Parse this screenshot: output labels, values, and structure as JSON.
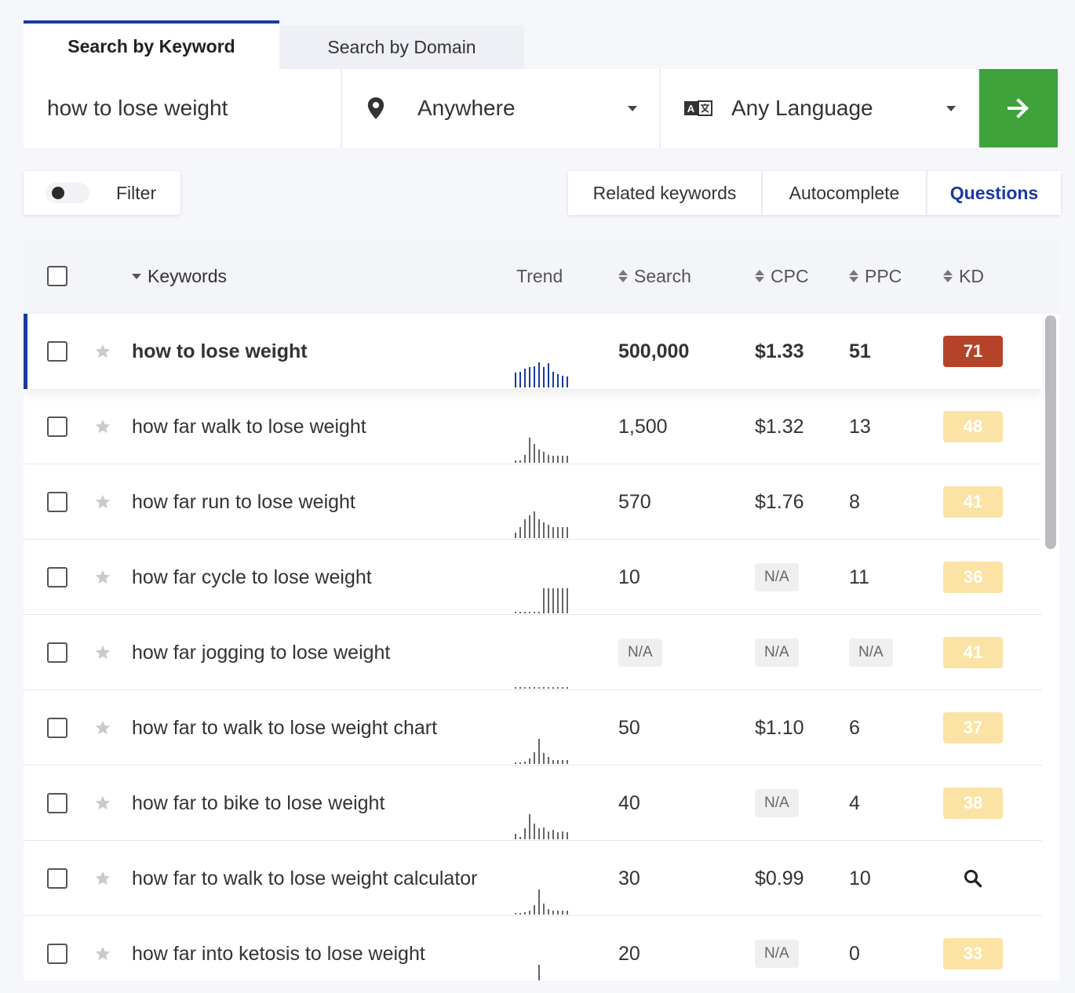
{
  "tabs": {
    "keyword_label": "Search by Keyword",
    "domain_label": "Search by Domain"
  },
  "search": {
    "keyword": "how to lose weight",
    "location": "Anywhere",
    "language": "Any Language"
  },
  "filter": {
    "label": "Filter",
    "enabled": false
  },
  "views": {
    "related": "Related keywords",
    "autocomplete": "Autocomplete",
    "questions": "Questions",
    "active": "questions"
  },
  "columns": {
    "keywords": "Keywords",
    "trend": "Trend",
    "search": "Search",
    "cpc": "CPC",
    "ppc": "PPC",
    "kd": "KD"
  },
  "colors": {
    "accent_blue": "#1b3aa0",
    "go_green": "#3da33a",
    "kd_hard": "#b5432a",
    "kd_medium": "#fbe3a6",
    "trend_selected": "#1b3aa0",
    "trend_default": "#666666"
  },
  "rows": [
    {
      "keyword": "how to lose weight",
      "search": "500,000",
      "cpc": "$1.33",
      "ppc": "51",
      "kd": "71",
      "kd_level": "hard",
      "selected": true,
      "trend": [
        0.55,
        0.6,
        0.7,
        0.75,
        0.8,
        0.95,
        0.75,
        0.9,
        0.6,
        0.5,
        0.45,
        0.4
      ]
    },
    {
      "keyword": "how far walk to lose weight",
      "search": "1,500",
      "cpc": "$1.32",
      "ppc": "13",
      "kd": "48",
      "kd_level": "medium",
      "selected": false,
      "trend": [
        0.1,
        0.1,
        0.3,
        0.95,
        0.7,
        0.5,
        0.4,
        0.3,
        0.25,
        0.25,
        0.25,
        0.25
      ]
    },
    {
      "keyword": "how far run to lose weight",
      "search": "570",
      "cpc": "$1.76",
      "ppc": "8",
      "kd": "41",
      "kd_level": "medium",
      "selected": false,
      "trend": [
        0.2,
        0.4,
        0.7,
        0.85,
        1.0,
        0.7,
        0.6,
        0.5,
        0.4,
        0.4,
        0.4,
        0.4
      ]
    },
    {
      "keyword": "how far cycle to lose weight",
      "search": "10",
      "cpc": "N/A",
      "ppc": "11",
      "kd": "36",
      "kd_level": "medium",
      "selected": false,
      "trend": [
        0.05,
        0.05,
        0.05,
        0.05,
        0.05,
        0.05,
        0.95,
        0.95,
        0.95,
        0.95,
        0.95,
        0.95
      ]
    },
    {
      "keyword": "how far jogging to lose weight",
      "search": "N/A",
      "cpc": "N/A",
      "ppc": "N/A",
      "kd": "41",
      "kd_level": "medium",
      "selected": false,
      "trend": [
        0.05,
        0.05,
        0.05,
        0.05,
        0.05,
        0.05,
        0.05,
        0.05,
        0.05,
        0.05,
        0.05,
        0.05
      ]
    },
    {
      "keyword": "how far to walk to lose weight chart",
      "search": "50",
      "cpc": "$1.10",
      "ppc": "6",
      "kd": "37",
      "kd_level": "medium",
      "selected": false,
      "trend": [
        0.05,
        0.05,
        0.1,
        0.2,
        0.45,
        0.95,
        0.4,
        0.25,
        0.15,
        0.15,
        0.15,
        0.15
      ]
    },
    {
      "keyword": "how far to bike to lose weight",
      "search": "40",
      "cpc": "N/A",
      "ppc": "4",
      "kd": "38",
      "kd_level": "medium",
      "selected": false,
      "trend": [
        0.2,
        0.1,
        0.4,
        0.95,
        0.6,
        0.4,
        0.45,
        0.3,
        0.35,
        0.25,
        0.3,
        0.25
      ]
    },
    {
      "keyword": "how far to walk to lose weight calculator",
      "search": "30",
      "cpc": "$0.99",
      "ppc": "10",
      "kd": "",
      "kd_level": "search",
      "selected": false,
      "trend": [
        0.05,
        0.05,
        0.1,
        0.15,
        0.35,
        0.95,
        0.4,
        0.2,
        0.15,
        0.15,
        0.15,
        0.15
      ]
    },
    {
      "keyword": "how far into ketosis to lose weight",
      "search": "20",
      "cpc": "N/A",
      "ppc": "0",
      "kd": "33",
      "kd_level": "medium",
      "selected": false,
      "trend": [
        0.0,
        0.0,
        0.0,
        0.0,
        0.0,
        0.95,
        0.25,
        0.0,
        0.0,
        0.0,
        0.0,
        0.0
      ]
    }
  ]
}
